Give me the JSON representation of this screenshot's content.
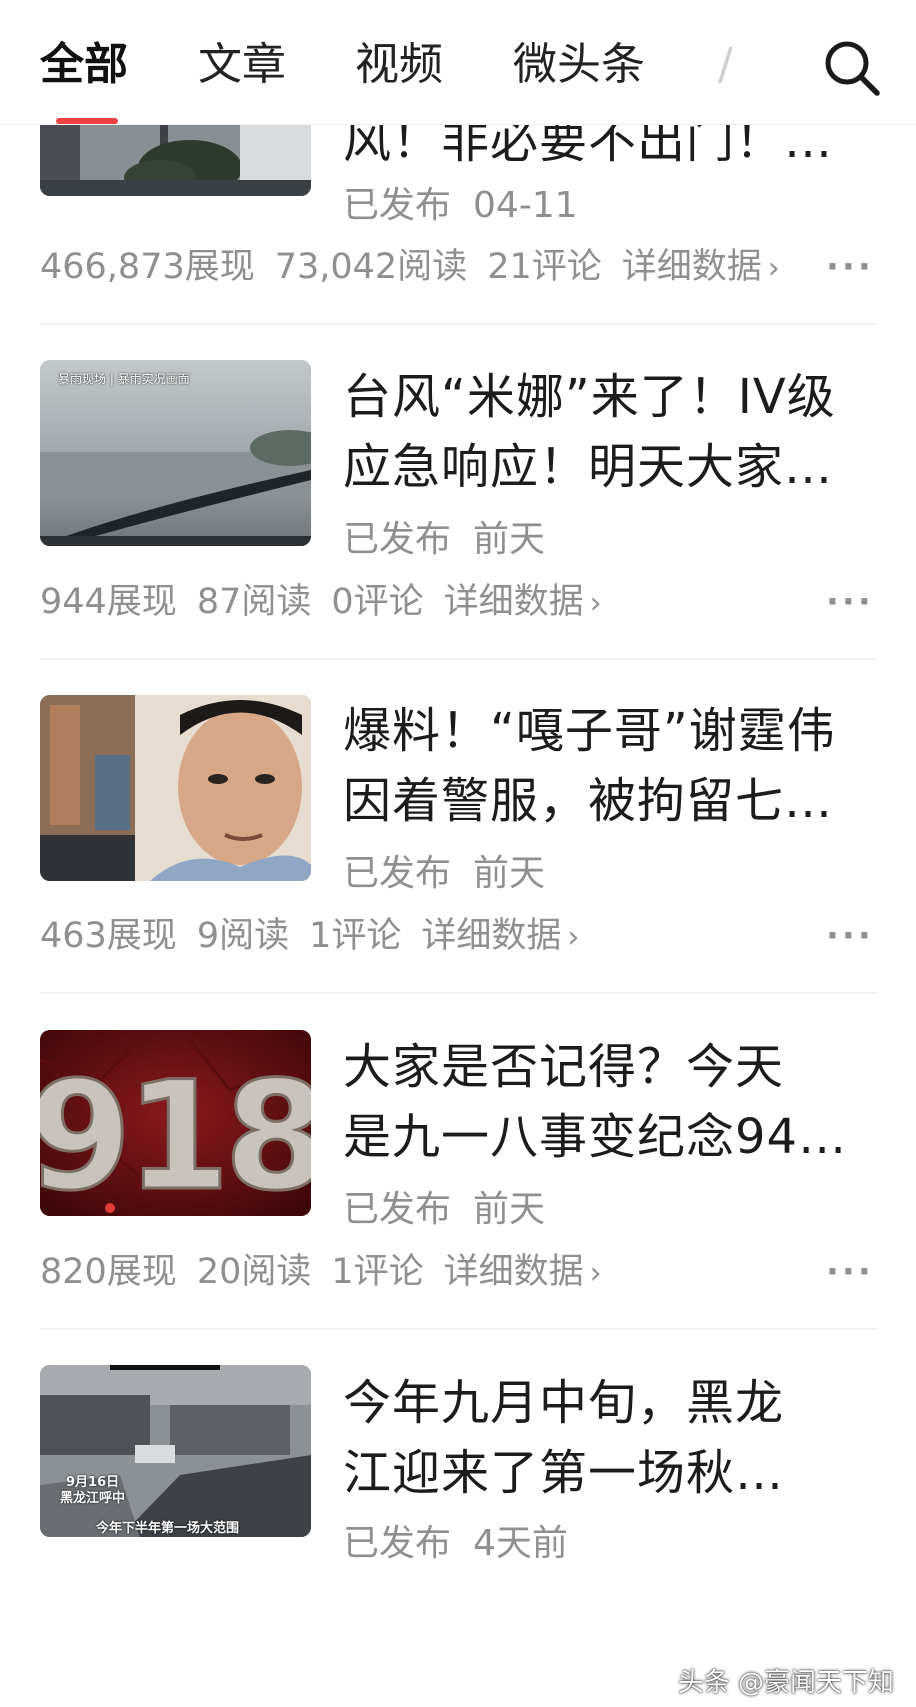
{
  "tabs": [
    {
      "label": "全部",
      "active": true
    },
    {
      "label": "文章",
      "active": false
    },
    {
      "label": "视频",
      "active": false
    },
    {
      "label": "微头条",
      "active": false
    },
    {
      "label": "/",
      "active": false
    }
  ],
  "accent_color": "#f04142",
  "articles": [
    {
      "title_line1": "风！非必要不出门！…",
      "title_line2": "",
      "status": "已发布",
      "date": "04-11",
      "impressions": "466,873展现",
      "reads": "73,042阅读",
      "comments": "21评论",
      "detail": "详细数据",
      "thumb_icon": "storm-street-thumbnail"
    },
    {
      "title_line1": "台风“米娜”来了！IV级",
      "title_line2": "应急响应！明天大家…",
      "status": "已发布",
      "date": "前天",
      "impressions": "944展现",
      "reads": "87阅读",
      "comments": "0评论",
      "detail": "详细数据",
      "thumb_caption": "暴雨现场 | 暴雨实况画面",
      "thumb_icon": "rainy-windshield-thumbnail"
    },
    {
      "title_line1": "爆料！“嘎子哥”谢霆伟",
      "title_line2": "因着警服，被拘留七…",
      "status": "已发布",
      "date": "前天",
      "impressions": "463展现",
      "reads": "9阅读",
      "comments": "1评论",
      "detail": "详细数据",
      "thumb_icon": "man-portrait-thumbnail"
    },
    {
      "title_line1": "大家是否记得？今天",
      "title_line2": "是九一八事变纪念94…",
      "status": "已发布",
      "date": "前天",
      "impressions": "820展现",
      "reads": "20阅读",
      "comments": "1评论",
      "detail": "详细数据",
      "thumb_big_text": "918",
      "thumb_icon": "918-poster-thumbnail"
    },
    {
      "title_line1": "今年九月中旬，黑龙",
      "title_line2": "江迎来了第一场秋…",
      "status": "已发布",
      "date": "4天前",
      "thumb_caption_1": "9月16日",
      "thumb_caption_2": "黑龙江呼中",
      "thumb_caption_3": "今年下半年第一场大范围",
      "thumb_icon": "snowy-village-thumbnail"
    }
  ],
  "more_glyph": "···",
  "chevron_glyph": "›",
  "watermark": "头条 @豪闻天下知"
}
